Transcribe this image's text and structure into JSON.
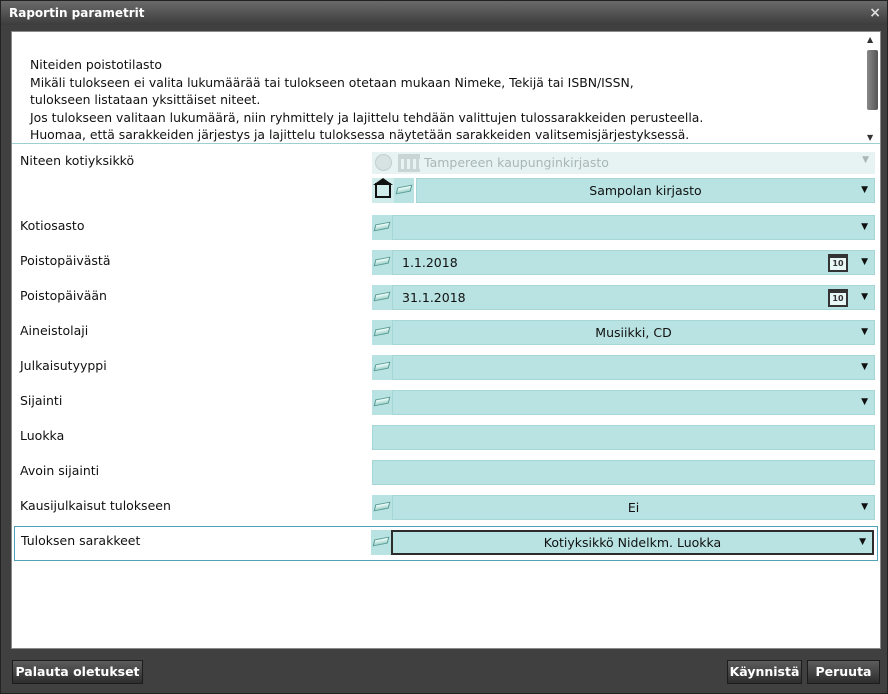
{
  "window": {
    "title": "Raportin parametrit",
    "close": "×"
  },
  "description": {
    "lines": [
      "Niteiden poistotilasto",
      "Mikäli tulokseen ei valita lukumäärää tai tulokseen otetaan mukaan Nimeke, Tekijä tai ISBN/ISSN,",
      "tulokseen listataan yksittäiset niteet.",
      "Jos tulokseen valitaan lukumäärä, niin ryhmittely ja lajittelu tehdään valittujen tulossarakkeiden perusteella.",
      "Huomaa, että sarakkeiden järjestys ja lajittelu tuloksessa näytetään sarakkeiden valitsemisjärjestyksessä."
    ]
  },
  "fields": {
    "home_unit": {
      "label": "Niteen kotiyksikkö",
      "disabled_value": "Tampereen kaupunginkirjasto",
      "value": "Sampolan kirjasto"
    },
    "department": {
      "label": "Kotiosasto",
      "value": ""
    },
    "date_from": {
      "label": "Poistopäivästä",
      "value": "1.1.2018"
    },
    "date_to": {
      "label": "Poistopäivään",
      "value": "31.1.2018"
    },
    "material_type": {
      "label": "Aineistolaji",
      "value": "Musiikki, CD"
    },
    "publication_type": {
      "label": "Julkaisutyyppi",
      "value": ""
    },
    "location": {
      "label": "Sijainti",
      "value": ""
    },
    "class": {
      "label": "Luokka",
      "value": ""
    },
    "open_location": {
      "label": "Avoin sijainti",
      "value": ""
    },
    "serials": {
      "label": "Kausijulkaisut tulokseen",
      "value": "Ei"
    },
    "result_columns": {
      "label": "Tuloksen sarakkeet",
      "value": "Kotiyksikkö Nidelkm. Luokka"
    }
  },
  "calendar_day": "10",
  "dropdown_arrow": "▼",
  "buttons": {
    "reset": "Palauta oletukset",
    "start": "Käynnistä",
    "cancel": "Peruuta"
  },
  "colors": {
    "field_bg": "#b8e3e2",
    "window_bg": "#404040"
  }
}
